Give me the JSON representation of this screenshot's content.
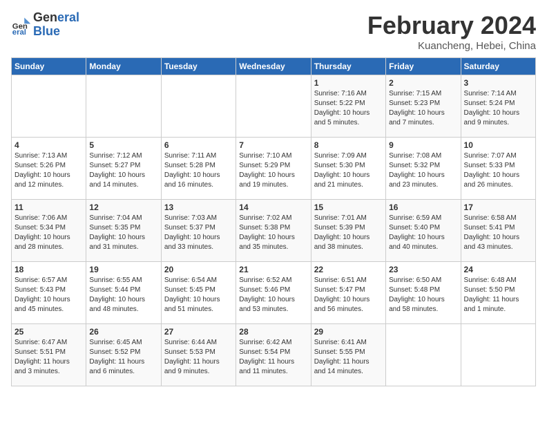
{
  "header": {
    "logo_line1": "General",
    "logo_line2": "Blue",
    "month_title": "February 2024",
    "location": "Kuancheng, Hebei, China"
  },
  "weekdays": [
    "Sunday",
    "Monday",
    "Tuesday",
    "Wednesday",
    "Thursday",
    "Friday",
    "Saturday"
  ],
  "weeks": [
    [
      {
        "day": "",
        "info": ""
      },
      {
        "day": "",
        "info": ""
      },
      {
        "day": "",
        "info": ""
      },
      {
        "day": "",
        "info": ""
      },
      {
        "day": "1",
        "info": "Sunrise: 7:16 AM\nSunset: 5:22 PM\nDaylight: 10 hours\nand 5 minutes."
      },
      {
        "day": "2",
        "info": "Sunrise: 7:15 AM\nSunset: 5:23 PM\nDaylight: 10 hours\nand 7 minutes."
      },
      {
        "day": "3",
        "info": "Sunrise: 7:14 AM\nSunset: 5:24 PM\nDaylight: 10 hours\nand 9 minutes."
      }
    ],
    [
      {
        "day": "4",
        "info": "Sunrise: 7:13 AM\nSunset: 5:26 PM\nDaylight: 10 hours\nand 12 minutes."
      },
      {
        "day": "5",
        "info": "Sunrise: 7:12 AM\nSunset: 5:27 PM\nDaylight: 10 hours\nand 14 minutes."
      },
      {
        "day": "6",
        "info": "Sunrise: 7:11 AM\nSunset: 5:28 PM\nDaylight: 10 hours\nand 16 minutes."
      },
      {
        "day": "7",
        "info": "Sunrise: 7:10 AM\nSunset: 5:29 PM\nDaylight: 10 hours\nand 19 minutes."
      },
      {
        "day": "8",
        "info": "Sunrise: 7:09 AM\nSunset: 5:30 PM\nDaylight: 10 hours\nand 21 minutes."
      },
      {
        "day": "9",
        "info": "Sunrise: 7:08 AM\nSunset: 5:32 PM\nDaylight: 10 hours\nand 23 minutes."
      },
      {
        "day": "10",
        "info": "Sunrise: 7:07 AM\nSunset: 5:33 PM\nDaylight: 10 hours\nand 26 minutes."
      }
    ],
    [
      {
        "day": "11",
        "info": "Sunrise: 7:06 AM\nSunset: 5:34 PM\nDaylight: 10 hours\nand 28 minutes."
      },
      {
        "day": "12",
        "info": "Sunrise: 7:04 AM\nSunset: 5:35 PM\nDaylight: 10 hours\nand 31 minutes."
      },
      {
        "day": "13",
        "info": "Sunrise: 7:03 AM\nSunset: 5:37 PM\nDaylight: 10 hours\nand 33 minutes."
      },
      {
        "day": "14",
        "info": "Sunrise: 7:02 AM\nSunset: 5:38 PM\nDaylight: 10 hours\nand 35 minutes."
      },
      {
        "day": "15",
        "info": "Sunrise: 7:01 AM\nSunset: 5:39 PM\nDaylight: 10 hours\nand 38 minutes."
      },
      {
        "day": "16",
        "info": "Sunrise: 6:59 AM\nSunset: 5:40 PM\nDaylight: 10 hours\nand 40 minutes."
      },
      {
        "day": "17",
        "info": "Sunrise: 6:58 AM\nSunset: 5:41 PM\nDaylight: 10 hours\nand 43 minutes."
      }
    ],
    [
      {
        "day": "18",
        "info": "Sunrise: 6:57 AM\nSunset: 5:43 PM\nDaylight: 10 hours\nand 45 minutes."
      },
      {
        "day": "19",
        "info": "Sunrise: 6:55 AM\nSunset: 5:44 PM\nDaylight: 10 hours\nand 48 minutes."
      },
      {
        "day": "20",
        "info": "Sunrise: 6:54 AM\nSunset: 5:45 PM\nDaylight: 10 hours\nand 51 minutes."
      },
      {
        "day": "21",
        "info": "Sunrise: 6:52 AM\nSunset: 5:46 PM\nDaylight: 10 hours\nand 53 minutes."
      },
      {
        "day": "22",
        "info": "Sunrise: 6:51 AM\nSunset: 5:47 PM\nDaylight: 10 hours\nand 56 minutes."
      },
      {
        "day": "23",
        "info": "Sunrise: 6:50 AM\nSunset: 5:48 PM\nDaylight: 10 hours\nand 58 minutes."
      },
      {
        "day": "24",
        "info": "Sunrise: 6:48 AM\nSunset: 5:50 PM\nDaylight: 11 hours\nand 1 minute."
      }
    ],
    [
      {
        "day": "25",
        "info": "Sunrise: 6:47 AM\nSunset: 5:51 PM\nDaylight: 11 hours\nand 3 minutes."
      },
      {
        "day": "26",
        "info": "Sunrise: 6:45 AM\nSunset: 5:52 PM\nDaylight: 11 hours\nand 6 minutes."
      },
      {
        "day": "27",
        "info": "Sunrise: 6:44 AM\nSunset: 5:53 PM\nDaylight: 11 hours\nand 9 minutes."
      },
      {
        "day": "28",
        "info": "Sunrise: 6:42 AM\nSunset: 5:54 PM\nDaylight: 11 hours\nand 11 minutes."
      },
      {
        "day": "29",
        "info": "Sunrise: 6:41 AM\nSunset: 5:55 PM\nDaylight: 11 hours\nand 14 minutes."
      },
      {
        "day": "",
        "info": ""
      },
      {
        "day": "",
        "info": ""
      }
    ]
  ]
}
